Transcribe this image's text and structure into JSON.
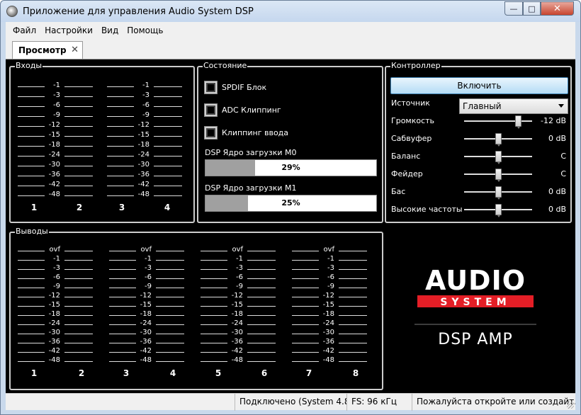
{
  "window": {
    "title": "Приложение для управления Audio System DSP"
  },
  "menu": {
    "file": "Файл",
    "settings": "Настройки",
    "view": "Вид",
    "help": "Помощь"
  },
  "tab": {
    "label": "Просмотр",
    "close": "✕"
  },
  "inputs": {
    "caption": "Входы",
    "scale": [
      "-1",
      "-3",
      "-6",
      "-9",
      "-12",
      "-15",
      "-18",
      "-24",
      "-30",
      "-36",
      "-42",
      "-48"
    ],
    "channels": [
      "1",
      "2",
      "3",
      "4"
    ]
  },
  "status": {
    "caption": "Состояние",
    "indicators": [
      "SPDIF Блок",
      "ADC Клиппинг",
      "Клиппинг ввода"
    ],
    "load_m0": {
      "label": "DSP Ядро загрузки M0",
      "text": "29%",
      "value": 29
    },
    "load_m1": {
      "label": "DSP Ядро загрузки M1",
      "text": "25%",
      "value": 25
    }
  },
  "controller": {
    "caption": "Контроллер",
    "enable_button": "Включить",
    "source_label": "Источник",
    "source_value": "Главный",
    "sliders": [
      {
        "label": "Громкость",
        "value": "-12 dB",
        "pos": 0.83
      },
      {
        "label": "Сабвуфер",
        "value": "0 dB",
        "pos": 0.5
      },
      {
        "label": "Баланс",
        "value": "C",
        "pos": 0.5
      },
      {
        "label": "Фейдер",
        "value": "C",
        "pos": 0.5
      },
      {
        "label": "Бас",
        "value": "0 dB",
        "pos": 0.5
      },
      {
        "label": "Высокие частоты",
        "value": "0 dB",
        "pos": 0.5
      }
    ]
  },
  "outputs": {
    "caption": "Выводы",
    "scale": [
      "ovf",
      "-1",
      "-3",
      "-6",
      "-9",
      "-12",
      "-15",
      "-18",
      "-24",
      "-30",
      "-36",
      "-42",
      "-48"
    ],
    "channels": [
      "1",
      "2",
      "3",
      "4",
      "5",
      "6",
      "7",
      "8"
    ]
  },
  "logo": {
    "line1": "AUDIO",
    "line2": "SYSTEM",
    "line3": "DSP AMP"
  },
  "statusbar": {
    "connection": "Подключено  (System 4.8)",
    "fs": "FS: 96 кГц",
    "message": "Пожалуйста откройте или создайт..."
  },
  "colors": {
    "logo_red": "#e41e26",
    "accent_button": "#b4dcf5"
  }
}
